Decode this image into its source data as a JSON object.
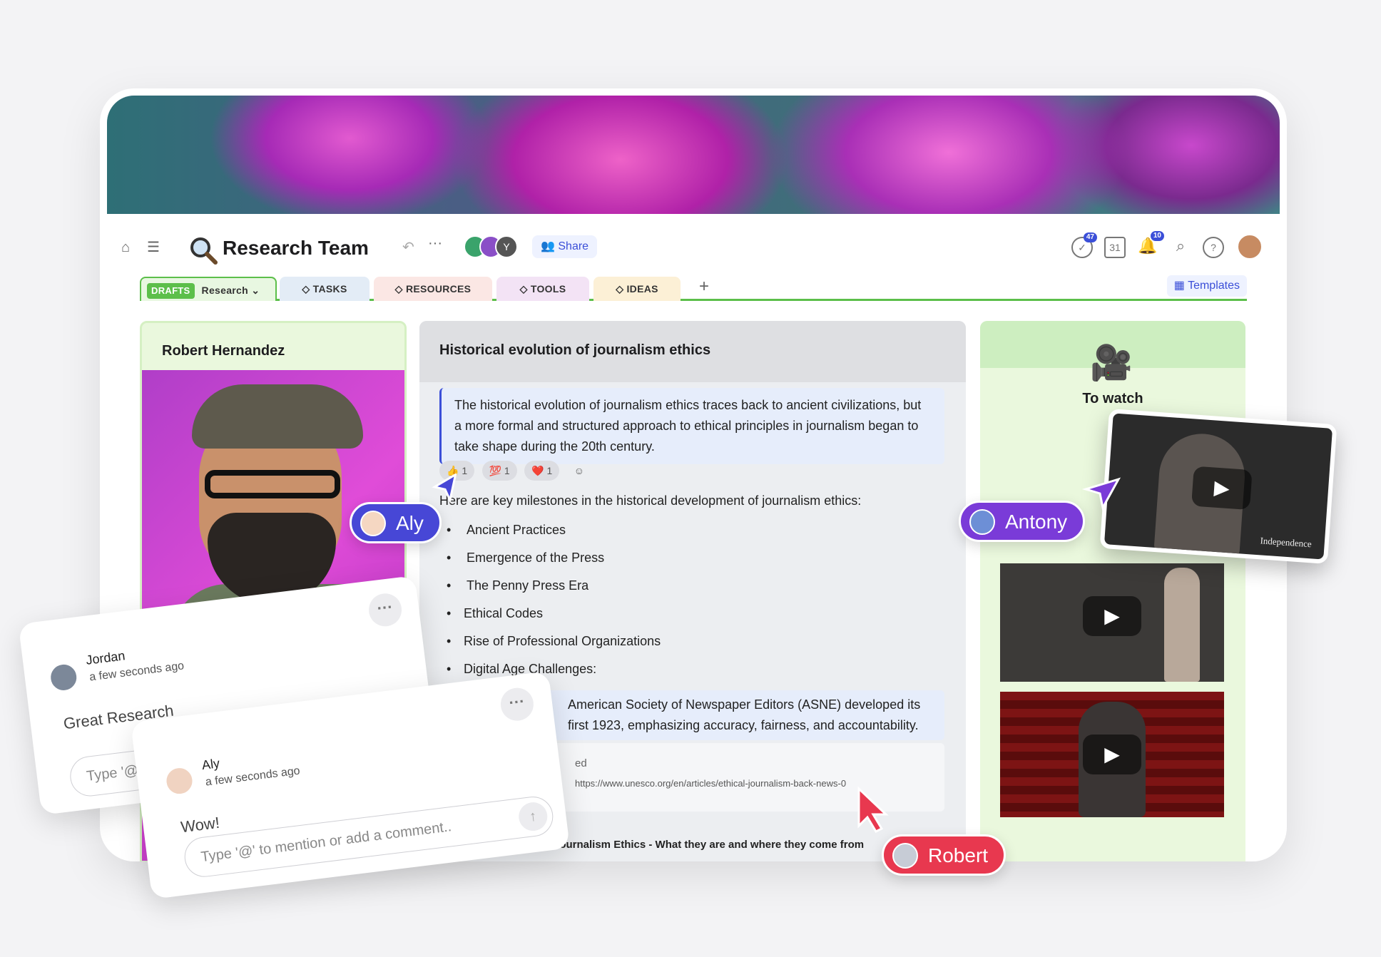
{
  "header": {
    "title": "Research Team",
    "share_label": "Share",
    "avatar_initial": "Y",
    "badges": {
      "tasks": "47",
      "notifications": "10"
    },
    "templates_label": "Templates"
  },
  "tabs": [
    {
      "pill": "DRAFTS",
      "label": "Research",
      "color": "#e8f7e1"
    },
    {
      "label": "TASKS",
      "color": "#e3ecf6"
    },
    {
      "label": "RESOURCES",
      "color": "#fbe7e4"
    },
    {
      "label": "TOOLS",
      "color": "#f3e3f5"
    },
    {
      "label": "IDEAS",
      "color": "#fcf0d6"
    }
  ],
  "left_panel": {
    "name": "Robert Hernandez"
  },
  "middle_panel": {
    "title": "Historical evolution of journalism ethics",
    "quote": "The historical evolution of journalism ethics traces back to ancient civilizations, but a more formal and structured approach to ethical principles in journalism began to take shape during the 20th century.",
    "reactions": [
      "👍 1",
      "💯 1",
      "❤️ 1",
      "☺"
    ],
    "intro": "Here are key milestones in the historical development of journalism ethics:",
    "milestones": [
      "Ancient Practices",
      "Emergence of the Press",
      "The Penny Press Era",
      "Ethical Codes",
      "Rise of Professional Organizations",
      "Digital Age Challenges:"
    ],
    "quote2": "American Society of Newspaper Editors (ASNE) developed its first 1923, emphasizing accuracy, fairness, and accountability.",
    "link_label": "ed",
    "link_url": "https://www.unesco.org/en/articles/ethical-journalism-back-news-0",
    "video_title": "Journalism Ethics - What they are and where they come from"
  },
  "right_panel": {
    "title": "To watch",
    "float_caption": "Independence"
  },
  "cursors": [
    {
      "name": "Aly",
      "color": "#4747d6"
    },
    {
      "name": "Antony",
      "color": "#7a3bd8"
    },
    {
      "name": "Robert",
      "color": "#e8384f"
    }
  ],
  "comments": [
    {
      "author": "Jordan",
      "time": "a few seconds ago",
      "text": "Great Research",
      "placeholder": "Type '@"
    },
    {
      "author": "Aly",
      "time": "a few seconds ago",
      "text": "Wow!",
      "placeholder": "Type '@' to mention or add a comment.."
    }
  ]
}
